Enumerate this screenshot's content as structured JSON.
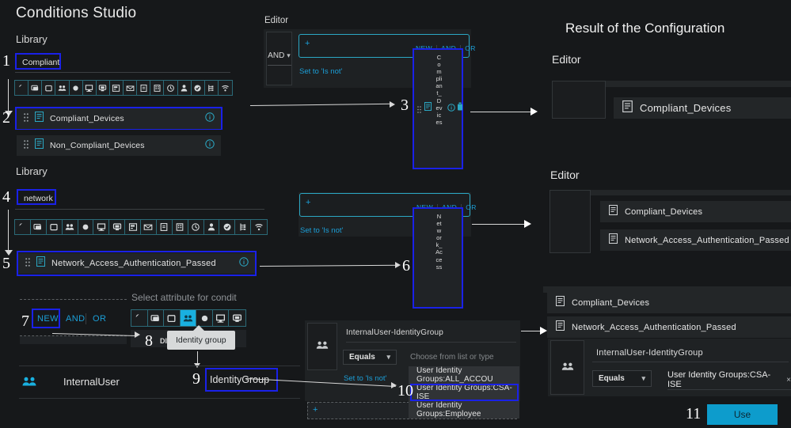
{
  "page": {
    "title": "Conditions Studio",
    "result_title": "Result of the Configuration",
    "bg_color": "#16181a",
    "accent_cyan": "#19b0e0",
    "annotation_blue": "#1a21e8",
    "use_button_color": "#0d9ccc"
  },
  "steps": {
    "s1": "1",
    "s2": "2",
    "s3": "3",
    "s4": "4",
    "s5": "5",
    "s6": "6",
    "s7": "7",
    "s8": "8",
    "s9": "9",
    "s10": "10",
    "s11": "11"
  },
  "library_1": {
    "label": "Library",
    "search_value": "Compliant",
    "rows": [
      {
        "name": "Compliant_Devices",
        "selected": true
      },
      {
        "name": "Non_Compliant_Devices",
        "selected": false
      }
    ]
  },
  "library_2": {
    "label": "Library",
    "search_value": "network",
    "rows": [
      {
        "name": "Network_Access_Authentication_Passed",
        "selected": true
      }
    ]
  },
  "icon_strip": [
    "location-pin-icon",
    "device-screen-icon",
    "square-icon",
    "identity-group-icon",
    "circle-icon",
    "monitor-icon",
    "display-icon",
    "form-icon",
    "envelope-icon",
    "document-icon",
    "building-icon",
    "clock-icon",
    "person-icon",
    "check-circle-icon",
    "network-tree-icon",
    "wifi-icon"
  ],
  "editor_1": {
    "label": "Editor",
    "and_label": "AND",
    "plus": "+",
    "set_to_is_not": "Set to 'Is not'",
    "new_label": "NEW",
    "and_btn_label": "AND",
    "or_label": "OR",
    "dragged_text": "Compliant_Devices"
  },
  "editor_2": {
    "plus": "+",
    "set_to_is_not": "Set to 'Is not'",
    "new_label": "NEW",
    "and_btn_label": "AND",
    "or_label": "OR",
    "dragged_text": "Network_Access"
  },
  "condition_builder": {
    "new_label": "NEW",
    "and_label": "AND",
    "or_label": "OR",
    "attribute_header": "Select attribute for condit",
    "tooltip": "Identity group",
    "dictionary_partial": "DI",
    "dictionary_name": "InternalUser",
    "attribute_name": "IdentityGroup"
  },
  "attribute_card": {
    "title": "InternalUser-IdentityGroup",
    "operator": "Equals",
    "set_to_is_not": "Set to 'Is not'",
    "value_placeholder": "Choose from list or type",
    "plus": "+",
    "options": [
      {
        "label": "User Identity Groups:ALL_ACCOU",
        "highlighted": false
      },
      {
        "label": "User Identity Groups:CSA-ISE",
        "highlighted": true
      },
      {
        "label": "User Identity Groups:Employee",
        "highlighted": false
      }
    ]
  },
  "result_1": {
    "editor_label": "Editor",
    "rows": [
      "Compliant_Devices"
    ]
  },
  "result_2": {
    "editor_label": "Editor",
    "rows": [
      "Compliant_Devices",
      "Network_Access_Authentication_Passed"
    ]
  },
  "result_3": {
    "rows": [
      "Compliant_Devices",
      "Network_Access_Authentication_Passed"
    ],
    "card": {
      "title": "InternalUser-IdentityGroup",
      "operator": "Equals",
      "value": "User Identity Groups:CSA-ISE",
      "remove": "×"
    },
    "use_label": "Use"
  }
}
